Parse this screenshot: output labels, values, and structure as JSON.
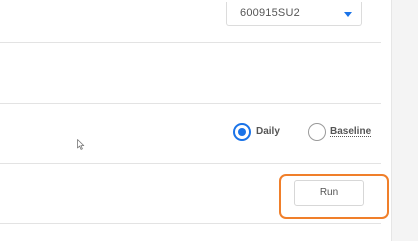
{
  "selector": {
    "value": "600915SU2"
  },
  "options": {
    "daily_label": "Daily",
    "baseline_label": "Baseline",
    "selected": "Daily"
  },
  "actions": {
    "run_label": "Run"
  },
  "colors": {
    "accent": "#1a73e8",
    "highlight": "#f07f2a"
  }
}
